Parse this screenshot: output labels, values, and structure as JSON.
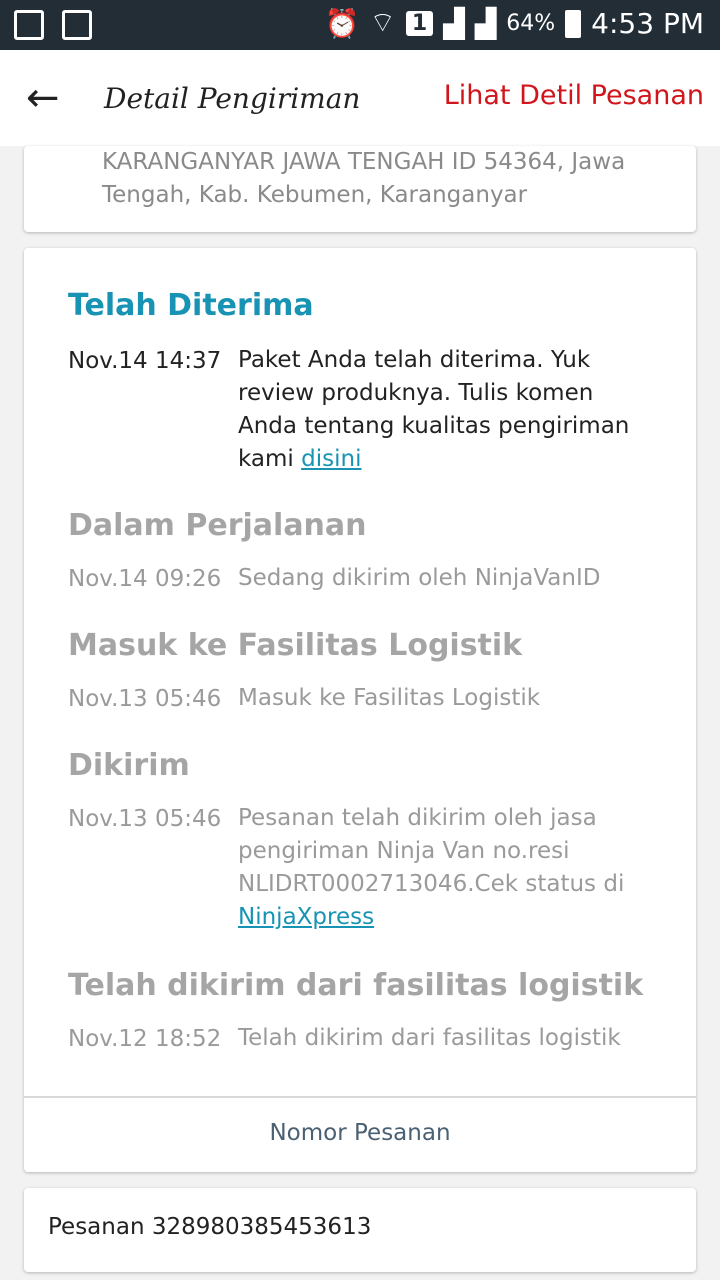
{
  "status_bar": {
    "battery": "64%",
    "time": "4:53 PM",
    "sim_badge": "1"
  },
  "header": {
    "title": "Detail Pengiriman",
    "action_link": "Lihat Detil Pesanan"
  },
  "address": {
    "text": "KARANGANYAR JAWA TENGAH ID 54364, Jawa Tengah, Kab. Kebumen, Karanganyar"
  },
  "tracking": [
    {
      "title": "Telah Diterima",
      "time": "Nov.14 14:37",
      "desc": "Paket Anda telah diterima. Yuk review produknya. Tulis komen Anda tentang kualitas pengiriman kami ",
      "link": "disini"
    },
    {
      "title": "Dalam Perjalanan",
      "time": "Nov.14 09:26",
      "desc": "Sedang dikirim oleh NinjaVanID"
    },
    {
      "title": "Masuk ke Fasilitas Logistik",
      "time": "Nov.13 05:46",
      "desc": "Masuk ke Fasilitas Logistik"
    },
    {
      "title": "Dikirim",
      "time": "Nov.13 05:46",
      "desc": "Pesanan telah dikirim oleh jasa pengiriman Ninja Van no.resi NLIDRT0002713046.Cek status di ",
      "link": "NinjaXpress"
    },
    {
      "title": "Telah dikirim dari fasilitas logistik",
      "time": "Nov.12 18:52",
      "desc": "Telah dikirim dari fasilitas logistik"
    }
  ],
  "footer_button": "Nomor Pesanan",
  "order": {
    "text": "Pesanan 328980385453613"
  },
  "colors": {
    "accent": "#1893b3",
    "header_link": "#d0151c",
    "status_bar": "#222d36"
  }
}
